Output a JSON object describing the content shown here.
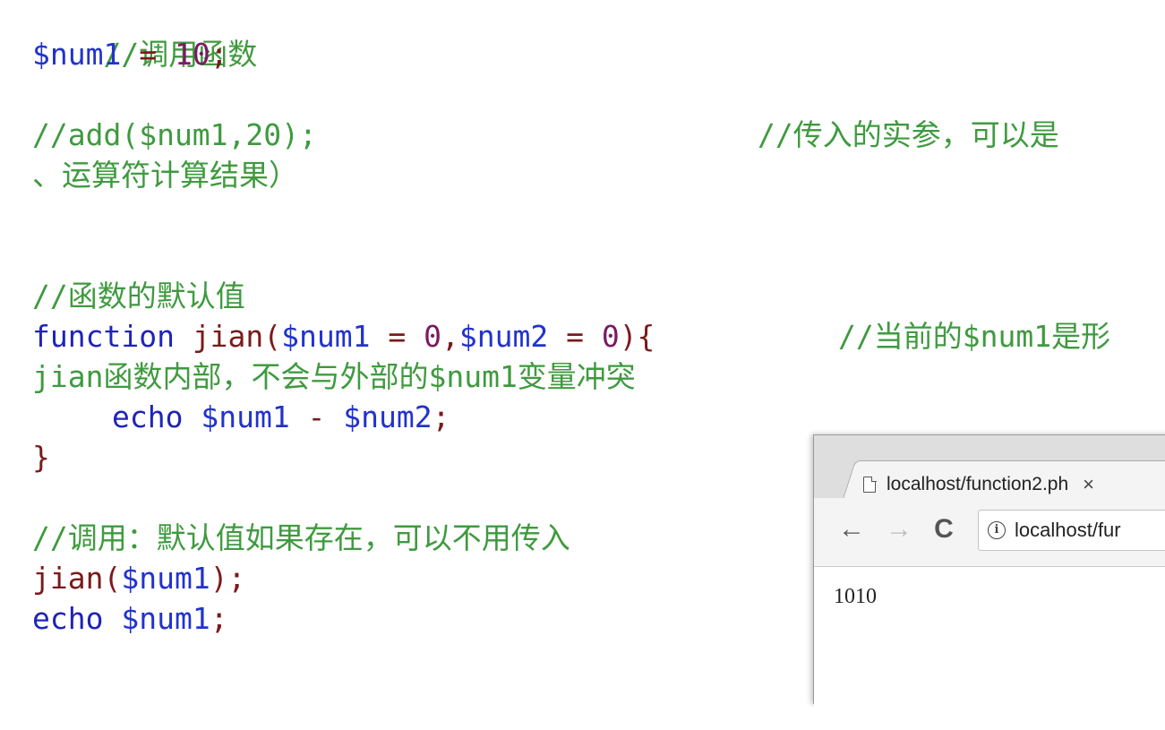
{
  "code": {
    "line1_comment": "//调用函数",
    "line2_var": "$num1",
    "line2_eq": " = ",
    "line2_num": "10",
    "line2_semi": ";",
    "line3_comment": "//add($num1,20);",
    "line3_right_comment": "//传入的实参，可以是",
    "line4_cont": "、运算符计算结果）",
    "line5_comment": "//函数的默认值",
    "line6_kw": "function ",
    "line6_fn": "jian(",
    "line6_var1": "$num1",
    "line6_eq1": " = ",
    "line6_num1": "0",
    "line6_comma": ",",
    "line6_var2": "$num2",
    "line6_eq2": " = ",
    "line6_num2": "0",
    "line6_close": "){",
    "line6_right_comment": "//当前的$num1是形",
    "line7_text": "jian函数内部，不会与外部的$num1变量冲突",
    "line8_kw": "echo ",
    "line8_var1": "$num1",
    "line8_minus": " - ",
    "line8_var2": "$num2",
    "line8_semi": ";",
    "line9_brace": "}",
    "line10_comment": "//调用：默认值如果存在，可以不用传入",
    "line11_fn": "jian(",
    "line11_var": "$num1",
    "line11_close": ");",
    "line12_kw": "echo ",
    "line12_var": "$num1",
    "line12_semi": ";"
  },
  "browser": {
    "tab_title": "localhost/function2.ph",
    "tab_close": "×",
    "back": "←",
    "forward": "→",
    "reload": "C",
    "info": "i",
    "url": "localhost/fur",
    "output": "1010"
  }
}
